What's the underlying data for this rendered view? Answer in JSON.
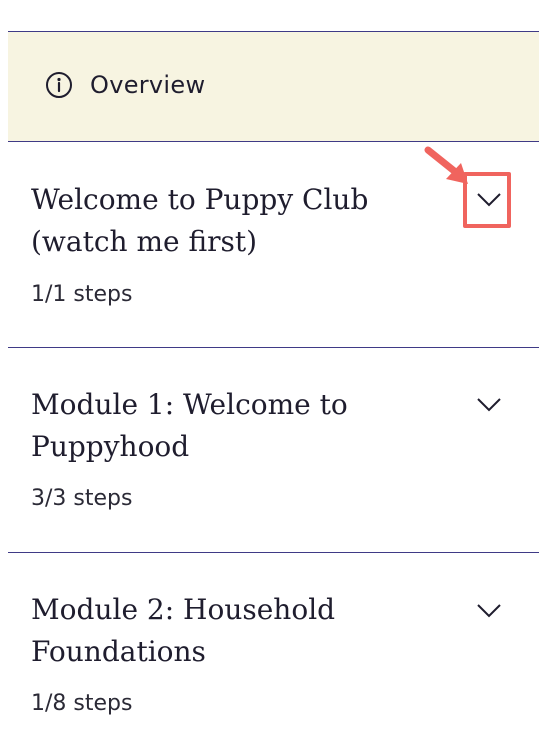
{
  "overview": {
    "label": "Overview",
    "icon": "info-icon"
  },
  "modules": [
    {
      "title_line1": "Welcome to Puppy Club",
      "title_line2": "(watch me first)",
      "steps": "1/1 steps",
      "icon": "chevron-down-icon"
    },
    {
      "title_line1": "Module 1: Welcome to",
      "title_line2": "Puppyhood",
      "steps": "3/3 steps",
      "icon": "chevron-down-icon"
    },
    {
      "title_line1": "Module 2: Household",
      "title_line2": "Foundations",
      "steps": "1/8 steps",
      "icon": "chevron-down-icon"
    }
  ],
  "annotation": {
    "color": "#f0645e",
    "icon": "pointer-arrow-icon"
  },
  "colors": {
    "overview_bg": "#f7f4e1",
    "divider": "#3f3a86",
    "text": "#1f1d2e"
  }
}
